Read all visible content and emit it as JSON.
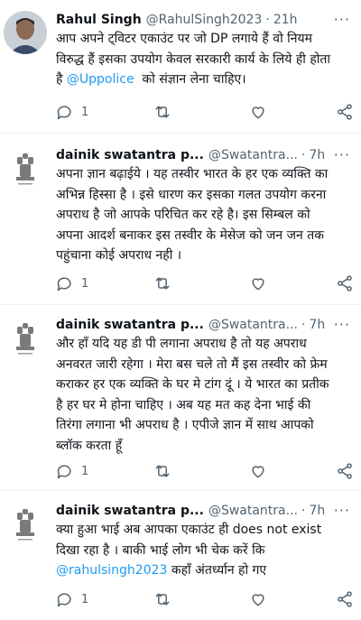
{
  "tweets": [
    {
      "name": "Rahul Singh",
      "handle": "@RahulSingh2023",
      "dot": "·",
      "time": "21h",
      "text_lines": [
        "आप अपने ट्विटर एकाउंट पर जो DP लगाये हैं वो नियम",
        "विरुद्ध हैं इसका उपयोग केवल सरकारी कार्य के लिये ही होता",
        "है"
      ],
      "mention": "@Uppolice",
      "after_mention": "को संज्ञान लेना चाहिए।",
      "reply_count": "1",
      "avatar_type": "person"
    },
    {
      "name": "dainik swatantra p...",
      "handle": "@Swatantra...",
      "dot": "·",
      "time": "7h",
      "text_lines": [
        "अपना ज्ञान बढ़ाईये । यह तस्वीर  भारत के हर एक व्यक्ति का",
        "अभिन्न हिस्सा है । इसे धारण कर इसका गलत उपयोग करना",
        "अपराध है जो आपके परिचित कर रहे है। इस सिम्बल को",
        "अपना आदर्श बनाकर इस तस्वीर के मेसेज को जन जन तक",
        "पहुंचाना कोई अपराध नही ।"
      ],
      "reply_count": "1",
      "avatar_type": "emblem"
    },
    {
      "name": "dainik swatantra p...",
      "handle": "@Swatantra...",
      "dot": "·",
      "time": "7h",
      "text_lines": [
        "और हाँ यदि यह डी पी लगाना अपराध है तो यह अपराध",
        "अनवरत जारी रहेगा । मेरा बस चले तो मैं  इस तस्वीर को फ्रेम",
        "कराकर हर एक व्यक्ति के घर मे टांग दूं । ये भारत का प्रतीक",
        "है हर घर मे होना चाहिए । अब यह मत कह देना भाई की",
        "तिरंगा लगाना भी अपराध है । एपीजे ज्ञान में साथ आपको",
        "ब्लॉक करता हूँ"
      ],
      "reply_count": "1",
      "avatar_type": "emblem"
    },
    {
      "name": "dainik swatantra p...",
      "handle": "@Swatantra...",
      "dot": "·",
      "time": "7h",
      "text_lines": [
        "क्या हुआ भाई अब आपका एकाउंट ही does not exist",
        "दिखा रहा है । बाकी भाई लोग भी चेक करें कि"
      ],
      "mention": "@rahulsingh2023",
      "after_mention": "कहाँ अंतर्ध्यान हो गए",
      "reply_count": "1",
      "avatar_type": "emblem"
    }
  ],
  "icons": {
    "reply": "reply-icon",
    "retweet": "retweet-icon",
    "like": "like-icon",
    "share": "share-icon",
    "more": "more-icon"
  },
  "colors": {
    "text": "#0f1419",
    "secondary": "#536471",
    "mention": "#1d9bf0",
    "divider": "#eff3f4"
  },
  "more_glyph": "···"
}
